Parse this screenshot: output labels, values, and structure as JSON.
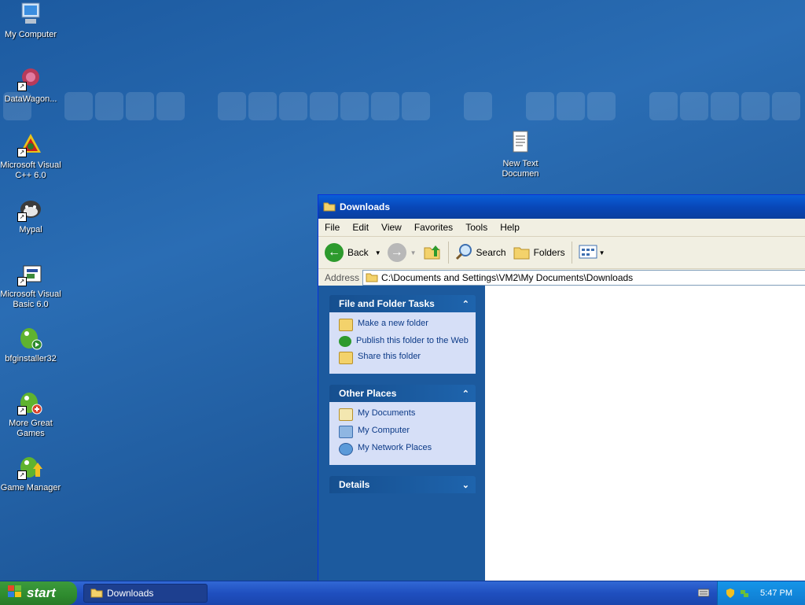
{
  "desktop": {
    "icons": [
      {
        "label": "My Computer",
        "icon": "computer-icon"
      },
      {
        "label": "DataWagon...",
        "icon": "datawagon-icon",
        "shortcut": true
      },
      {
        "label": "Microsoft Visual C++ 6.0",
        "icon": "visual-cpp-icon",
        "shortcut": true
      },
      {
        "label": "Mypal",
        "icon": "mypal-icon",
        "shortcut": true
      },
      {
        "label": "Microsoft Visual Basic 6.0",
        "icon": "visual-basic-icon",
        "shortcut": true
      },
      {
        "label": "bfginstaller32",
        "icon": "bfg-installer-icon"
      },
      {
        "label": "More Great Games",
        "icon": "games-icon",
        "shortcut": true
      },
      {
        "label": "Game Manager",
        "icon": "game-manager-icon",
        "shortcut": true
      },
      {
        "label": "New Text Documen",
        "icon": "text-document-icon"
      }
    ]
  },
  "window": {
    "title": "Downloads",
    "menu": [
      "File",
      "Edit",
      "View",
      "Favorites",
      "Tools",
      "Help"
    ],
    "toolbar": {
      "back_label": "Back",
      "search_label": "Search",
      "folders_label": "Folders"
    },
    "address": {
      "label": "Address",
      "value": "C:\\Documents and Settings\\VM2\\My Documents\\Downloads"
    },
    "tasks": {
      "title": "File and Folder Tasks",
      "items": [
        "Make a new folder",
        "Publish this folder to the Web",
        "Share this folder"
      ]
    },
    "places": {
      "title": "Other Places",
      "items": [
        "My Documents",
        "My Computer",
        "My Network Places"
      ]
    },
    "details": {
      "title": "Details"
    }
  },
  "taskbar": {
    "start_label": "start",
    "task_item": "Downloads",
    "clock": "5:47 PM"
  },
  "colors": {
    "desktop": "#1c5aa0",
    "start_green": "#2e8b2e",
    "taskpane": "#1c5a9e",
    "link": "#0c3a87"
  }
}
